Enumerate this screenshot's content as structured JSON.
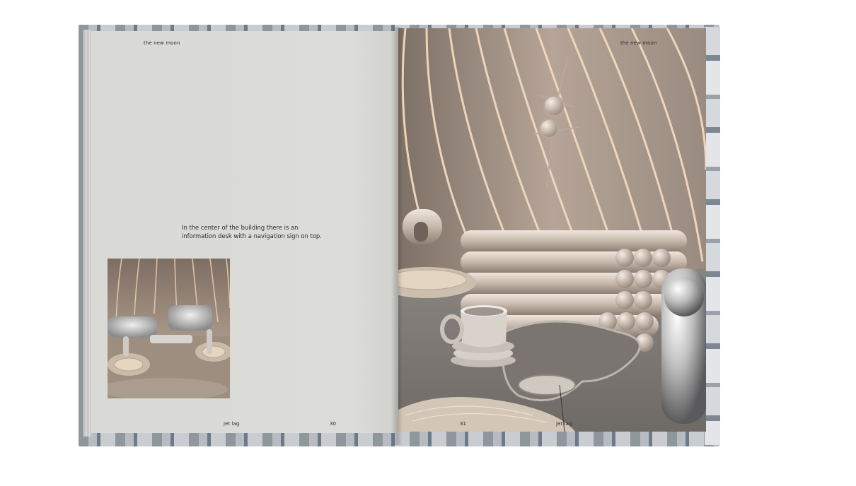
{
  "spread": {
    "left_page": {
      "running_head": "the new moon",
      "body_text": "In the center of the building there is an information desk with a navigation sign on top.",
      "footer_title": "jet lag",
      "page_number": "30"
    },
    "right_page": {
      "running_head": "the new moon",
      "page_number": "31",
      "footer_title": "jet lag"
    }
  },
  "colors": {
    "paper": "#dcdcd8",
    "text": "#2b2b2b",
    "cover_blue": "#6f7a88"
  }
}
